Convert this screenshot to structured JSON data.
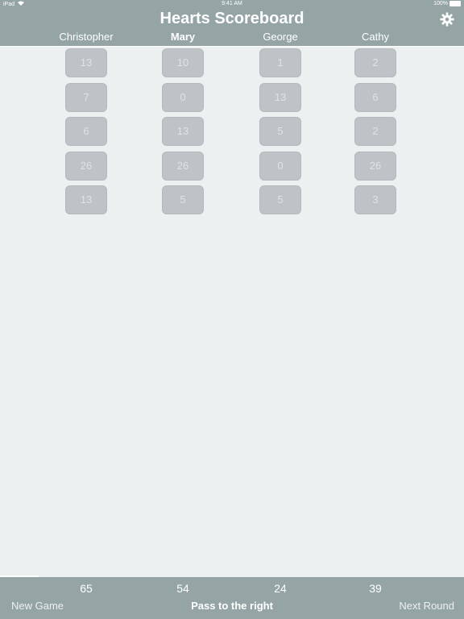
{
  "status": {
    "device": "iPad",
    "time": "9:41 AM",
    "battery": "100%"
  },
  "header": {
    "title": "Hearts Scoreboard",
    "settings_icon": "gear-icon"
  },
  "players": [
    {
      "name": "Christopher",
      "current": false,
      "scores": [
        "13",
        "7",
        "6",
        "26",
        "13"
      ],
      "total": "65"
    },
    {
      "name": "Mary",
      "current": true,
      "scores": [
        "10",
        "0",
        "13",
        "26",
        "5"
      ],
      "total": "54"
    },
    {
      "name": "George",
      "current": false,
      "scores": [
        "1",
        "13",
        "5",
        "0",
        "5"
      ],
      "total": "24"
    },
    {
      "name": "Cathy",
      "current": false,
      "scores": [
        "2",
        "6",
        "2",
        "26",
        "3"
      ],
      "total": "39"
    }
  ],
  "footer": {
    "new_game_label": "New Game",
    "pass_label": "Pass to the right",
    "next_round_label": "Next Round"
  },
  "colors": {
    "bar": "#95a5a6",
    "background": "#ecf0f1",
    "cell": "#bdc3c7"
  }
}
